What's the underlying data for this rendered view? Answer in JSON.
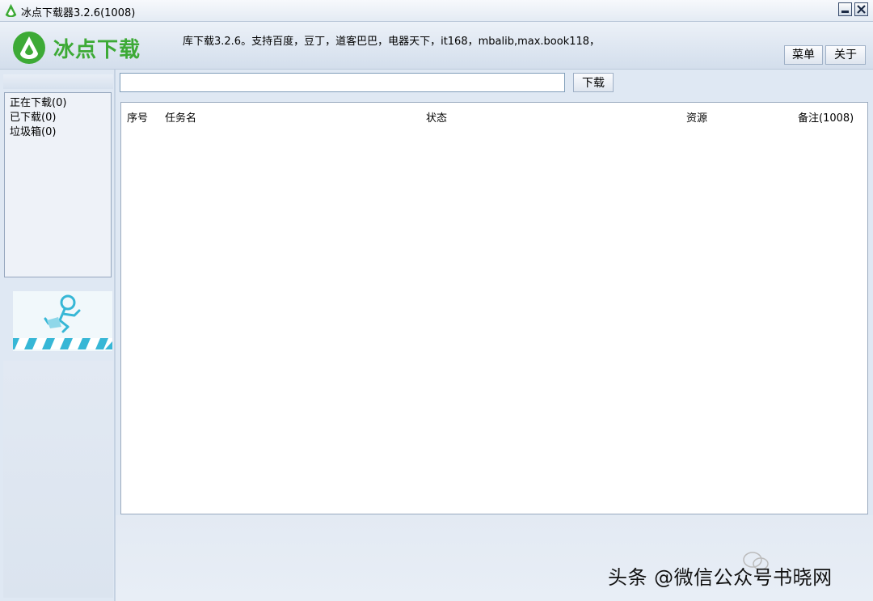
{
  "window": {
    "title": "冰点下载器3.2.6(1008)",
    "minimize_icon": "minimize-icon",
    "close_icon": "close-icon"
  },
  "header": {
    "logo_text": "冰点下载",
    "marquee": "库下载3.2.6。支持百度，豆丁，道客巴巴，电器天下，it168，mbalib,max.book118，",
    "menu_label": "菜单",
    "about_label": "关于"
  },
  "search": {
    "value": "",
    "placeholder": "",
    "download_label": "下载"
  },
  "categories": [
    {
      "label": "正在下载(0)"
    },
    {
      "label": "已下载(0)"
    },
    {
      "label": "垃圾箱(0)"
    }
  ],
  "table": {
    "columns": [
      "序号",
      "任务名",
      "状态",
      "资源",
      "备注(1008)"
    ],
    "rows": []
  },
  "watermark": "头条 @微信公众号书晓网",
  "colors": {
    "brand_green": "#3daa36",
    "banner_cyan": "#37b7d6"
  }
}
